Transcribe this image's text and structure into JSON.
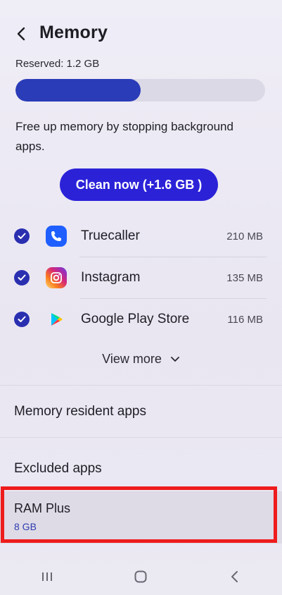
{
  "header": {
    "title": "Memory",
    "back_icon": "back-arrow-icon"
  },
  "memory": {
    "reserved_label": "Reserved: 1.2 GB",
    "usage_fraction": 0.5,
    "description": "Free up memory by stopping background apps.",
    "clean_button_label": "Clean now (+1.6 GB )"
  },
  "apps": [
    {
      "name": "Truecaller",
      "size": "210 MB",
      "icon": "truecaller-icon",
      "checked": true
    },
    {
      "name": "Instagram",
      "size": "135 MB",
      "icon": "instagram-icon",
      "checked": true
    },
    {
      "name": "Google Play Store",
      "size": "116 MB",
      "icon": "google-play-store-icon",
      "checked": true
    }
  ],
  "view_more_label": "View more",
  "menu": {
    "memory_resident_apps": "Memory resident apps",
    "excluded_apps": "Excluded apps",
    "ram_plus": {
      "title": "RAM Plus",
      "value": "8 GB"
    }
  },
  "colors": {
    "accent": "#2b22d8",
    "progress": "#2a3cb8",
    "highlight": "#ee1c1c"
  }
}
